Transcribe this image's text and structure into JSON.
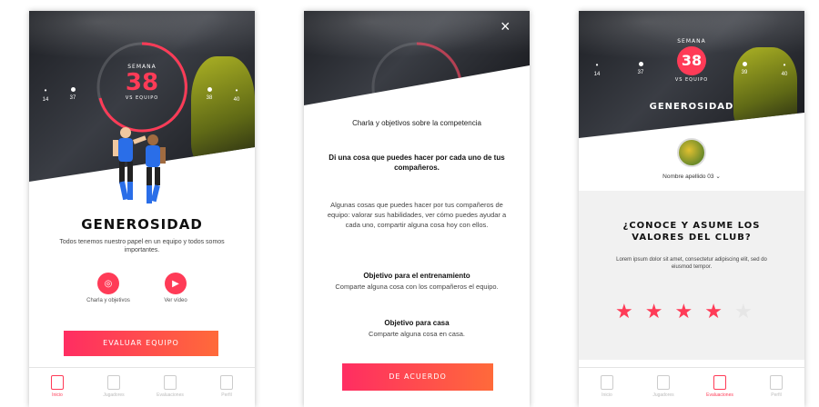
{
  "colors": {
    "accent": "#ff3b57",
    "cta_start": "#ff2d62",
    "cta_end": "#ff6a3a"
  },
  "screen1": {
    "week_label": "SEMANA",
    "week_number": "38",
    "week_sub": "VS EQUIPO",
    "dots": [
      {
        "top": "•",
        "num": "14"
      },
      {
        "top": "•",
        "num": "37"
      },
      {
        "top": "•",
        "num": "38"
      },
      {
        "top": "•",
        "num": "40"
      }
    ],
    "value_title": "GENEROSIDAD",
    "value_desc": "Todos tenemos nuestro papel en un equipo y todos somos importantes.",
    "action_1": "Charla y objetivos",
    "action_2": "Ver vídeo",
    "cta": "EVALUAR EQUIPO",
    "tabs": [
      "Inicio",
      "Jugadores",
      "Evaluaciones",
      "Perfil"
    ],
    "active_tab": 0
  },
  "screen2": {
    "close_icon": "×",
    "heading": "Charla y objetivos sobre la competencia",
    "question": "Di una cosa que puedes hacer por cada uno de tus compañeros.",
    "body": "Algunas cosas que puedes hacer por tus compañeros de equipo: valorar sus habilidades, ver cómo puedes ayudar a cada uno, compartir alguna cosa hoy con ellos.",
    "obj1_title": "Objetivo para el entrenamiento",
    "obj1_text": "Comparte alguna cosa con los compañeros el equipo.",
    "obj2_title": "Objetivo para casa",
    "obj2_text": "Comparte alguna cosa en casa.",
    "cta": "DE ACUERDO"
  },
  "screen3": {
    "week_label": "SEMANA",
    "week_number": "38",
    "week_sub": "VS EQUIPO",
    "dots": [
      {
        "num": "14"
      },
      {
        "num": "37"
      },
      {
        "num": "39"
      },
      {
        "num": "40"
      }
    ],
    "value_title": "GENEROSIDAD",
    "player_name": "Nombre apellido 03",
    "question": "¿CONOCE Y ASUME LOS VALORES DEL CLUB?",
    "lorem": "Lorem ipsum dolor sit amet, consectetur adipiscing elit, sed do eiusmod tempor.",
    "rating": 4,
    "rating_max": 5,
    "tabs": [
      "Inicio",
      "Jugadores",
      "Evaluaciones",
      "Perfil"
    ],
    "active_tab": 2
  }
}
